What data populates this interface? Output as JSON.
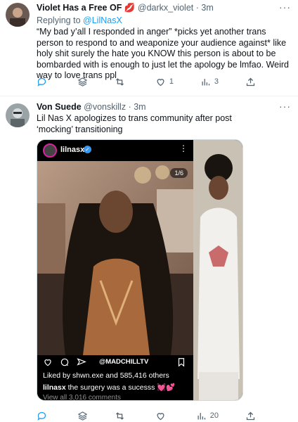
{
  "tweet1": {
    "name": "Violet Has a Free OF 💋",
    "handle": "@darkx_violet",
    "time": "· 3m",
    "replying_label": "Replying to",
    "replying_to": "@LilNasX",
    "text": "“My bad y’all I responded in anger” *picks yet another trans person to respond to and weaponize your audience against* like holy shit surely the hate you KNOW this person is about to be bombarded with is enough to just let the apology be lmfao. Weird way to love trans ppl",
    "more": "···",
    "reply_count": "",
    "retweet_count": "",
    "like_count": "1",
    "view_count": "3"
  },
  "tweet2": {
    "name": "Von Suede",
    "handle": "@vonskillz",
    "time": "· 3m",
    "text": "Lil Nas X apologizes to trans community after post ‘mocking’ transitioning",
    "more": "···",
    "reply_count": "",
    "retweet_count": "",
    "like_count": "",
    "view_count": "20"
  },
  "media": {
    "ig_user": "lilnasx",
    "verified_mark": "✓",
    "counter": "1/6",
    "channel": "@MADCHILLTV",
    "likes": "Liked by shwn.exe and 585,416 others",
    "caption_user": "lilnasx",
    "caption_text": " the surgery was a sucesss 💓💕",
    "comments": "View all 3,016 comments",
    "dots": "⋮"
  },
  "colors": {
    "accent": "#1d9bf0",
    "muted": "#536471",
    "text": "#0f1419"
  }
}
